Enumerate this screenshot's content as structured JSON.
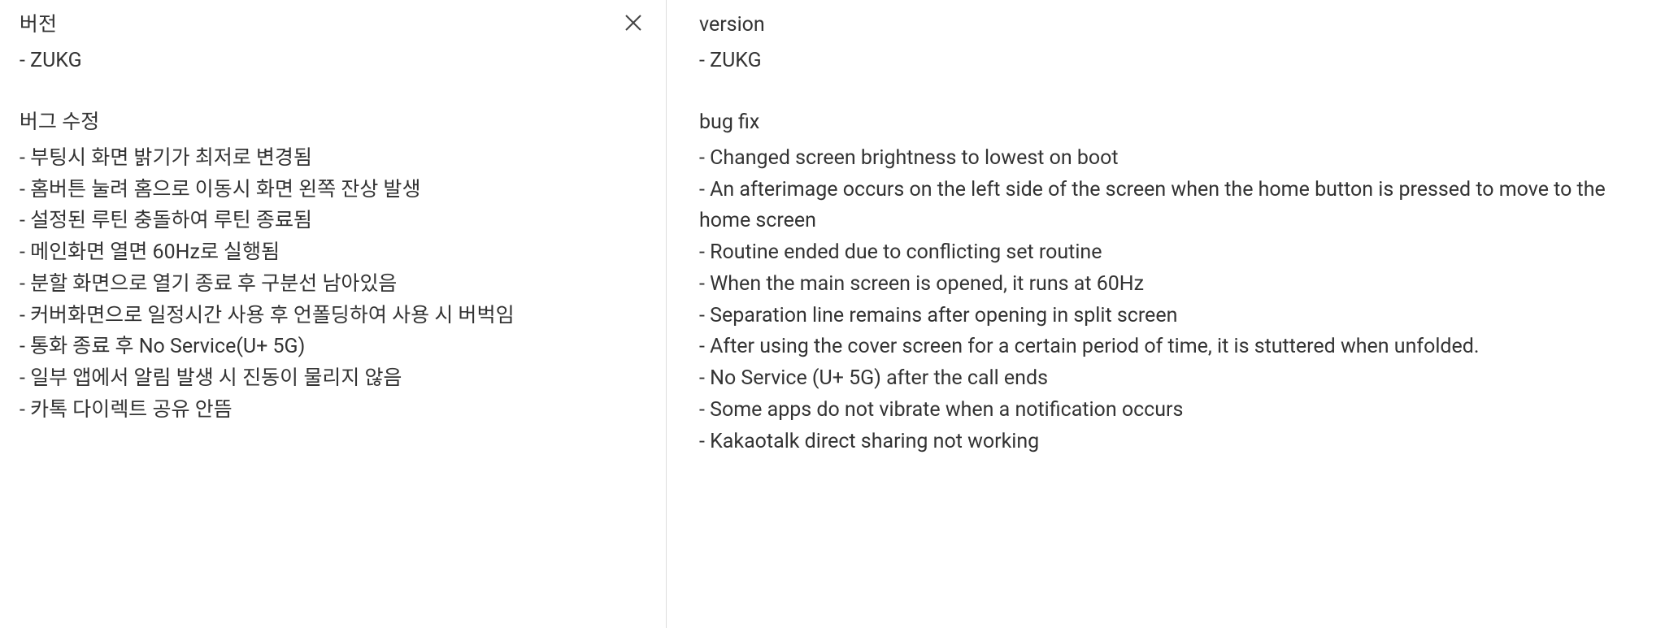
{
  "left": {
    "versionLabel": "버전",
    "versionValue": "- ZUKG",
    "bugFixLabel": "버그 수정",
    "bugFixItems": [
      "- 부팅시 화면 밝기가 최저로 변경됨",
      "- 홈버튼 눌려 홈으로 이동시 화면 왼쪽 잔상 발생",
      "- 설정된 루틴 충돌하여 루틴 종료됨",
      "- 메인화면 열면 60Hz로 실행됨",
      "- 분할 화면으로 열기 종료 후 구분선 남아있음",
      "- 커버화면으로 일정시간 사용 후 언폴딩하여 사용 시 버벅임",
      "- 통화 종료 후 No Service(U+ 5G)",
      "- 일부 앱에서 알림 발생 시 진동이 물리지 않음",
      "- 카톡 다이렉트 공유 안뜸"
    ]
  },
  "right": {
    "versionLabel": "version",
    "versionValue": "- ZUKG",
    "bugFixLabel": "bug fix",
    "bugFixItems": [
      "- Changed screen brightness to lowest on boot",
      "- An afterimage occurs on the left side of the screen when the home button is pressed to move to the home screen",
      "- Routine ended due to conflicting set routine",
      "- When the main screen is opened, it runs at 60Hz",
      "- Separation line remains after opening in split screen",
      "- After using the cover screen for a certain period of time, it is stuttered when unfolded.",
      "- No Service (U+ 5G) after the call ends",
      "- Some apps do not vibrate when a notification occurs",
      "- Kakaotalk direct sharing not working"
    ]
  }
}
